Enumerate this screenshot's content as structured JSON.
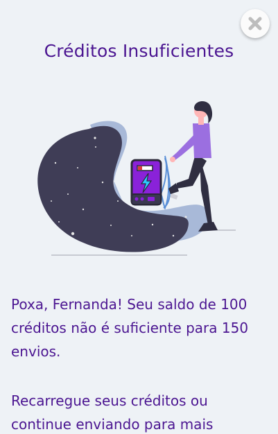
{
  "modal": {
    "title": "Créditos Insuficientes",
    "close_icon": "close-icon",
    "message_paragraph_1": "Poxa, Fernanda! Seu saldo de 100 créditos não é suficiente para 150 envios.",
    "message_paragraph_2": "Recarregue seus créditos ou continue enviando para mais"
  },
  "illustration": {
    "name": "woman-with-battery-illustration",
    "colors": {
      "blob_dark": "#3f3d56",
      "blob_light": "#a8b9d8",
      "battery_purple": "#8a22d9",
      "shirt_purple": "#9b6fe0",
      "cable_blue": "#5a8fd6"
    }
  },
  "colors": {
    "background": "#eef2f6",
    "text_purple": "#4b1591",
    "close_button_bg": "#fbfbfb",
    "close_icon": "#bdbdbd"
  }
}
